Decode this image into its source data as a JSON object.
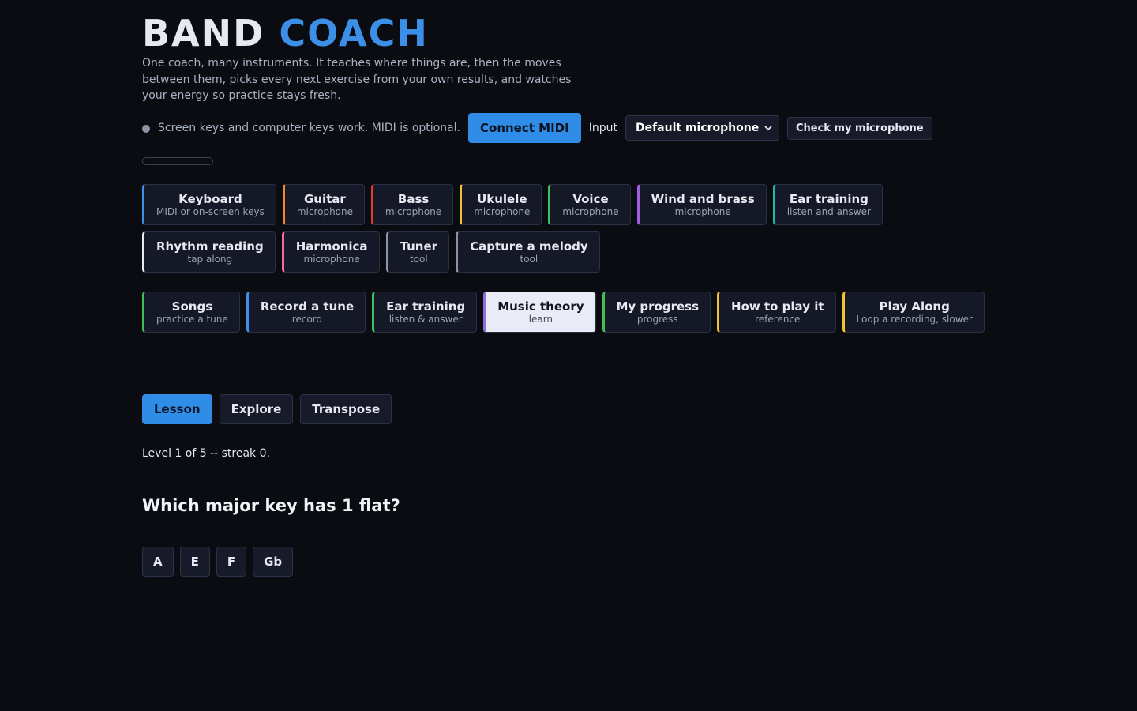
{
  "header": {
    "title_part1": "BAND",
    "title_part2": "COACH",
    "tagline": "One coach, many instruments. It teaches where things are, then the moves between them, picks every next exercise from your own results, and watches your energy so practice stays fresh."
  },
  "status": {
    "text": "Screen keys and computer keys work. MIDI is optional.",
    "connect_label": "Connect MIDI",
    "input_label": "Input",
    "input_selected": "Default microphone",
    "check_label": "Check my microphone",
    "progress": 0
  },
  "instruments": [
    {
      "name": "Keyboard",
      "sub": "MIDI or on-screen keys",
      "color": "#3b8fe6"
    },
    {
      "name": "Guitar",
      "sub": "microphone",
      "color": "#f08a24"
    },
    {
      "name": "Bass",
      "sub": "microphone",
      "color": "#e53935"
    },
    {
      "name": "Ukulele",
      "sub": "microphone",
      "color": "#f2c230"
    },
    {
      "name": "Voice",
      "sub": "microphone",
      "color": "#3fbf5a"
    },
    {
      "name": "Wind and brass",
      "sub": "microphone",
      "color": "#a25ee0"
    },
    {
      "name": "Ear training",
      "sub": "listen and answer",
      "color": "#22b8a8"
    },
    {
      "name": "Rhythm reading",
      "sub": "tap along",
      "color": "#e6e9f0"
    },
    {
      "name": "Harmonica",
      "sub": "microphone",
      "color": "#f06ba8"
    },
    {
      "name": "Tuner",
      "sub": "tool",
      "color": "#8b93a5"
    },
    {
      "name": "Capture a melody",
      "sub": "tool",
      "color": "#8b93a5"
    }
  ],
  "sections": [
    {
      "name": "Songs",
      "sub": "practice a tune",
      "color": "#3fbf5a"
    },
    {
      "name": "Record a tune",
      "sub": "record",
      "color": "#3b8fe6"
    },
    {
      "name": "Ear training",
      "sub": "listen & answer",
      "color": "#3fbf5a"
    },
    {
      "name": "Music theory",
      "sub": "learn",
      "color": "#8a6ee0"
    },
    {
      "name": "My progress",
      "sub": "progress",
      "color": "#3fbf5a"
    },
    {
      "name": "How to play it",
      "sub": "reference",
      "color": "#f2c230"
    },
    {
      "name": "Play Along",
      "sub": "Loop a recording, slower",
      "color": "#f2c230"
    }
  ],
  "mode_tabs": [
    "Lesson",
    "Explore",
    "Transpose"
  ],
  "lesson": {
    "level_text": "Level 1 of 5 -- streak 0.",
    "question": "Which major key has 1 flat?",
    "answers": [
      "A",
      "E",
      "F",
      "Gb"
    ]
  }
}
